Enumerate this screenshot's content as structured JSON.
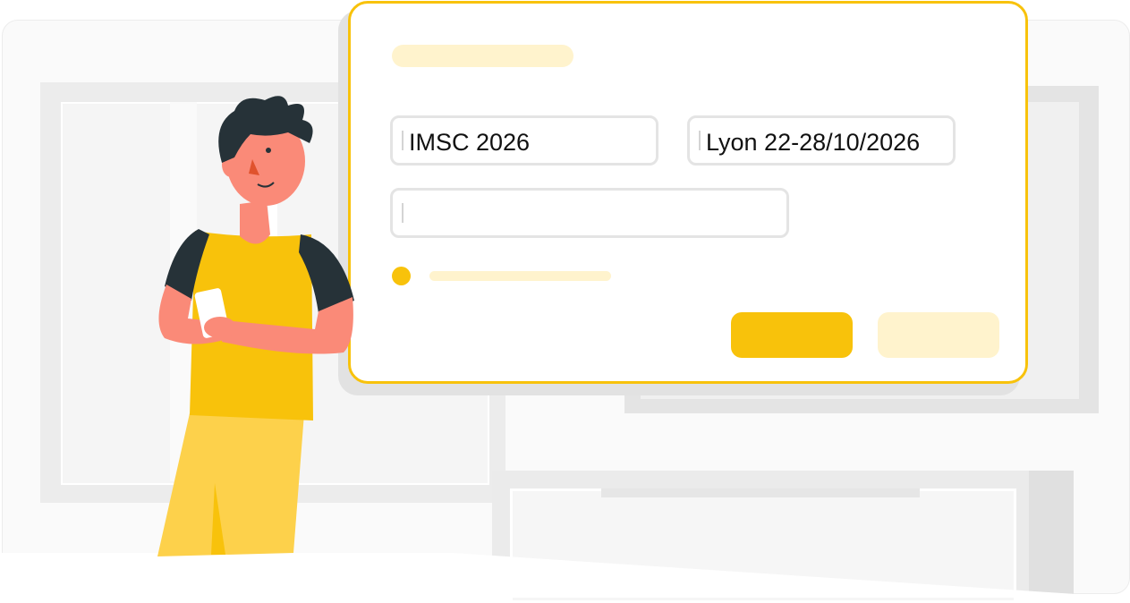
{
  "form": {
    "field_1_value": "IMSC 2026",
    "field_2_value": "Lyon 22-28/10/2026",
    "field_3_value": ""
  },
  "colors": {
    "accent": "#f8c20b",
    "accent_light": "#fff3cd",
    "field_border": "#e4e4e4",
    "skin": "#fa8a78",
    "hair": "#263238",
    "pants": "#fdd14b"
  },
  "illustration": {
    "subject": "person-holding-phone"
  }
}
